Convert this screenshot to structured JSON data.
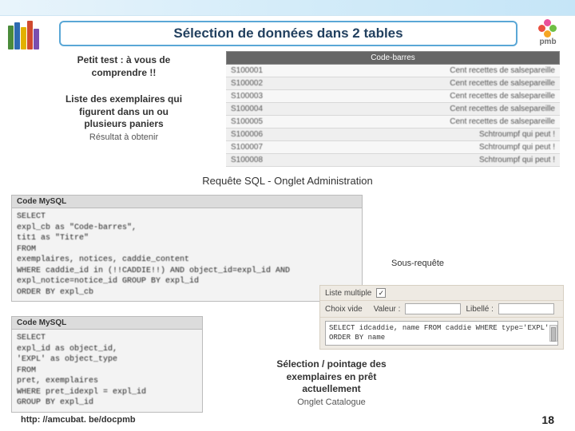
{
  "header": {
    "title": "Sélection de données dans 2 tables",
    "logo_text": "pmb"
  },
  "left": {
    "line1": "Petit test : à vous de",
    "line2": "comprendre !!",
    "line3": "Liste des exemplaires qui",
    "line4": "figurent dans un ou",
    "line5": "plusieurs paniers",
    "sub": "Résultat à obtenir"
  },
  "barcode": {
    "col1": "",
    "col2": "Code-barres",
    "rows": [
      {
        "code": "S100001",
        "title": "Cent recettes de salsepareille"
      },
      {
        "code": "S100002",
        "title": "Cent recettes de salsepareille"
      },
      {
        "code": "S100003",
        "title": "Cent recettes de salsepareille"
      },
      {
        "code": "S100004",
        "title": "Cent recettes de salsepareille"
      },
      {
        "code": "S100005",
        "title": "Cent recettes de salsepareille"
      },
      {
        "code": "S100006",
        "title": "Schtroumpf qui peut !"
      },
      {
        "code": "S100007",
        "title": "Schtroumpf qui peut !"
      },
      {
        "code": "S100008",
        "title": "Schtroumpf qui peut !"
      }
    ]
  },
  "mid_title": "Requête SQL - Onglet Administration",
  "code1": {
    "head": "Code MySQL",
    "body": "SELECT\nexpl_cb as \"Code-barres\",\ntit1 as \"Titre\"\nFROM\nexemplaires, notices, caddie_content\nWHERE caddie_id in (!!CADDIE!!) AND object_id=expl_id AND\nexpl_notice=notice_id GROUP BY expl_id\nORDER BY expl_cb"
  },
  "sous_requete": "Sous-requête",
  "form": {
    "liste_multiple": "Liste multiple",
    "choix_vide": "Choix vide",
    "valeur": "Valeur :",
    "libelle": "Libellé :",
    "sql": "SELECT idcaddie, name FROM caddie WHERE type='EXPL'\nORDER BY name"
  },
  "code2": {
    "head": "Code MySQL",
    "body": "SELECT\nexpl_id as object_id,\n'EXPL' as object_type\nFROM\npret, exemplaires\nWHERE pret_idexpl = expl_id\nGROUP BY expl_id"
  },
  "sel": {
    "line1": "Sélection / pointage des",
    "line2": "exemplaires en prêt",
    "line3": "actuellement",
    "sub": "Onglet Catalogue"
  },
  "footer": {
    "url": "http: //amcubat. be/docpmb",
    "page": "18"
  }
}
